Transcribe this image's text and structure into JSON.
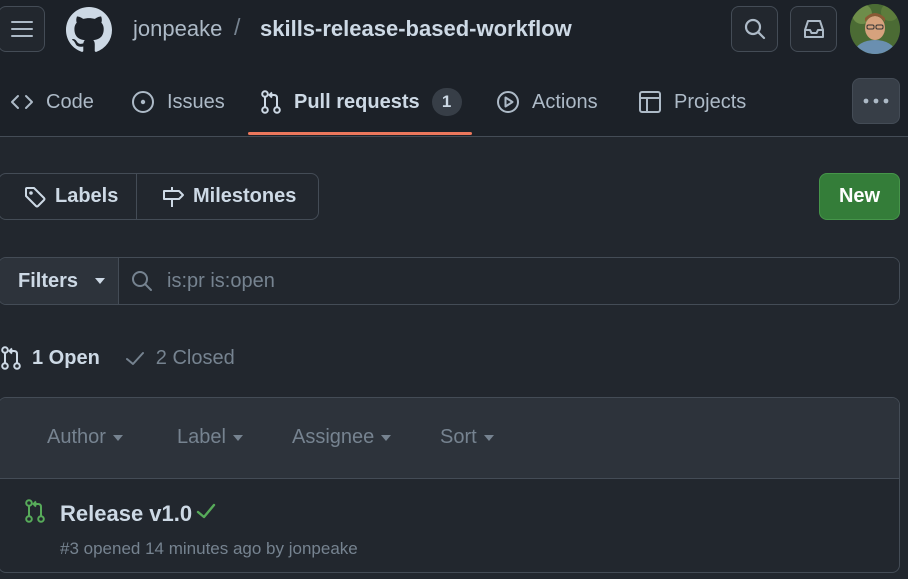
{
  "repo": {
    "owner": "jonpeake",
    "separator": "/",
    "name": "skills-release-based-workflow"
  },
  "nav": {
    "tabs": [
      {
        "label": "Code",
        "icon": "code-icon"
      },
      {
        "label": "Issues",
        "icon": "issue-icon"
      },
      {
        "label": "Pull requests",
        "icon": "pull-request-icon",
        "count": "1"
      },
      {
        "label": "Actions",
        "icon": "play-icon"
      },
      {
        "label": "Projects",
        "icon": "table-icon"
      }
    ]
  },
  "toolbar": {
    "labels": "Labels",
    "milestones": "Milestones",
    "new": "New"
  },
  "filter": {
    "filters_label": "Filters",
    "search_value": "is:pr is:open"
  },
  "states": {
    "open": "1 Open",
    "closed": "2 Closed"
  },
  "list_header": {
    "author": "Author",
    "label": "Label",
    "assignee": "Assignee",
    "sort": "Sort"
  },
  "pull_requests": [
    {
      "title": "Release v1.0",
      "meta": "#3 opened 14 minutes ago by jonpeake",
      "status": "success"
    }
  ],
  "colors": {
    "accent_underline": "#ec775c",
    "primary_button": "#347d39",
    "open_icon": "#57ab5a"
  }
}
